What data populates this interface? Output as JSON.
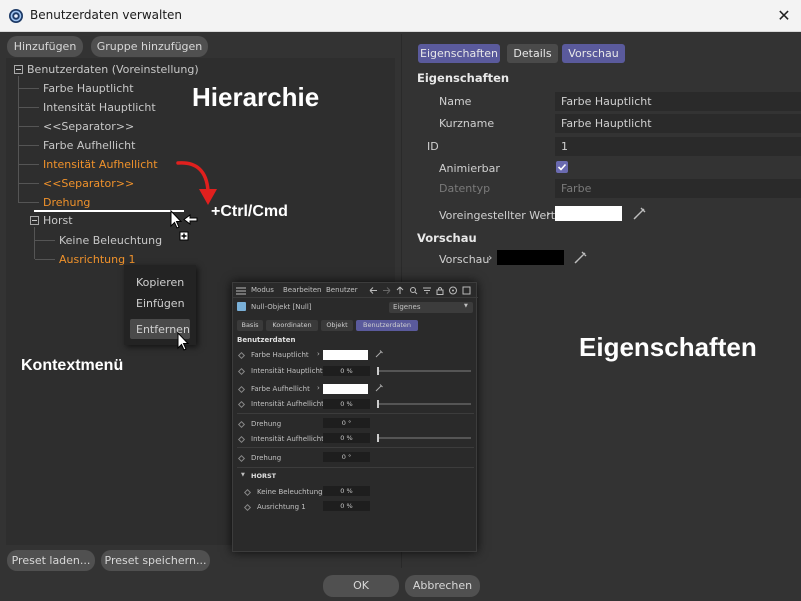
{
  "window": {
    "title": "Benutzerdaten verwalten",
    "close_symbol": "✕"
  },
  "toolbar": {
    "add_label": "Hinzufügen",
    "add_group_label": "Gruppe hinzufügen"
  },
  "tree": {
    "root": "Benutzerdaten (Voreinstellung)",
    "items": [
      "Farbe Hauptlicht",
      "Intensität Hauptlicht",
      "<<Separator>>",
      "Farbe Aufhellicht",
      "Intensität Aufhellicht",
      "<<Separator>>",
      "Drehung"
    ],
    "group": "Horst",
    "group_items": [
      "Keine Beleuchtung",
      "Ausrichtung 1"
    ]
  },
  "annotations": {
    "hierarchy": "Hierarchie",
    "ctrl": "+Ctrl/Cmd",
    "context_menu": "Kontextmenü",
    "properties": "Eigenschaften"
  },
  "context_menu": {
    "items": [
      "Kopieren",
      "Einfügen",
      "Entfernen"
    ]
  },
  "bottom": {
    "load_preset": "Preset laden...",
    "save_preset": "Preset speichern...",
    "ok": "OK",
    "cancel": "Abbrechen"
  },
  "right": {
    "tabs": [
      "Eigenschaften",
      "Details",
      "Vorschau"
    ],
    "section_properties": "Eigenschaften",
    "name_label": "Name",
    "name_value": "Farbe Hauptlicht",
    "short_label": "Kurzname",
    "short_value": "Farbe Hauptlicht",
    "id_label": "ID",
    "id_value": "1",
    "animatable_label": "Animierbar",
    "animatable_checked": true,
    "datatype_label": "Datentyp",
    "datatype_value": "Farbe",
    "default_label": "Voreingestellter Wert",
    "section_preview": "Vorschau",
    "preview_label": "Vorschau",
    "default_color": "#ffffff",
    "preview_color": "#000000"
  },
  "embedded": {
    "menu": [
      "Modus",
      "Bearbeiten",
      "Benutzer"
    ],
    "object": "Null-Objekt [Null]",
    "dropdown": "Eigenes",
    "tabs": [
      "Basis",
      "Koordinaten",
      "Objekt",
      "Benutzerdaten"
    ],
    "section": "Benutzerdaten",
    "rows": [
      {
        "label": "Farbe Hauptlicht",
        "kind": "color"
      },
      {
        "label": "Intensität Hauptlicht",
        "value": "0 %",
        "kind": "slider"
      },
      {
        "label": "Farbe Aufhellicht",
        "kind": "color"
      },
      {
        "label": "Intensität Aufhellicht",
        "value": "0 %",
        "kind": "slider"
      },
      {
        "label": "Drehung",
        "value": "0 °",
        "kind": "field"
      },
      {
        "label": "Intensität Aufhellicht",
        "value": "0 %",
        "kind": "slider"
      },
      {
        "label": "Drehung",
        "value": "0 °",
        "kind": "field"
      }
    ],
    "group": "HORST",
    "group_rows": [
      {
        "label": "Keine Beleuchtung",
        "value": "0 %"
      },
      {
        "label": "Ausrichtung 1",
        "value": "0 %"
      }
    ]
  },
  "colors": {
    "accent": "#5a5a9c",
    "orange": "#f0922b"
  }
}
